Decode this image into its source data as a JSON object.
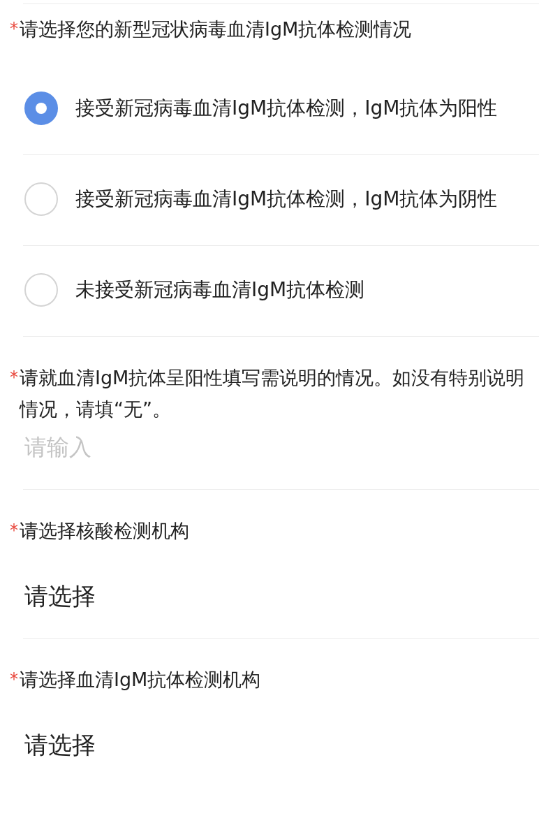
{
  "questions": [
    {
      "kind": "radio",
      "marker": "*",
      "label": "请选择您的新型冠状病毒血清IgM抗体检测情况",
      "options": [
        {
          "label": "接受新冠病毒血清IgM抗体检测，IgM抗体为阳性",
          "selected": true
        },
        {
          "label": "接受新冠病毒血清IgM抗体检测，IgM抗体为阴性",
          "selected": false
        },
        {
          "label": "未接受新冠病毒血清IgM抗体检测",
          "selected": false
        }
      ]
    },
    {
      "kind": "text",
      "marker": "*",
      "label": "请就血清IgM抗体呈阳性填写需说明的情况。如没有特别说明情况，请填“无”。",
      "placeholder": "请输入"
    },
    {
      "kind": "select",
      "marker": "*",
      "label": "请选择核酸检测机构",
      "value": "请选择"
    },
    {
      "kind": "select",
      "marker": "*",
      "label": "请选择血清IgM抗体检测机构",
      "value": "请选择"
    }
  ]
}
